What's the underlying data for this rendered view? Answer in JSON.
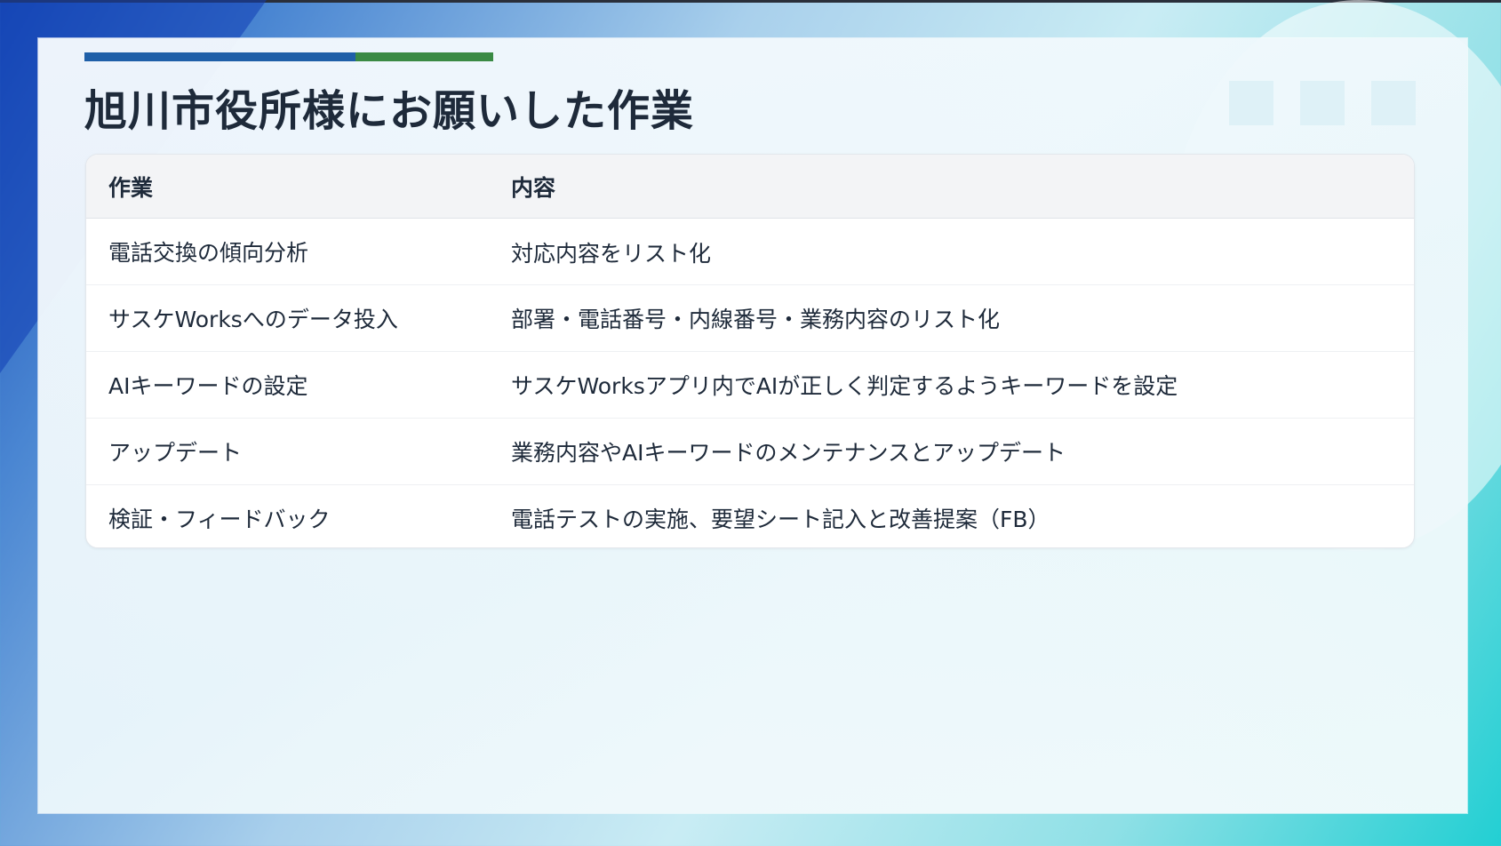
{
  "page": {
    "title": "旭川市役所様にお願いした作業"
  },
  "colors": {
    "accent_blue": "#1f5fa8",
    "accent_green": "#3a8a44",
    "text": "#1e2a3a",
    "header_bg": "#f3f4f6"
  },
  "table": {
    "headers": [
      "作業",
      "内容"
    ],
    "rows": [
      [
        "電話交換の傾向分析",
        "対応内容をリスト化"
      ],
      [
        "サスケWorksへのデータ投入",
        "部署・電話番号・内線番号・業務内容のリスト化"
      ],
      [
        "AIキーワードの設定",
        "サスケWorksアプリ内でAIが正しく判定するようキーワードを設定"
      ],
      [
        "アップデート",
        "業務内容やAIキーワードのメンテナンスとアップデート"
      ],
      [
        "検証・フィードバック",
        "電話テストの実施、要望シート記入と改善提案（FB）"
      ]
    ]
  }
}
